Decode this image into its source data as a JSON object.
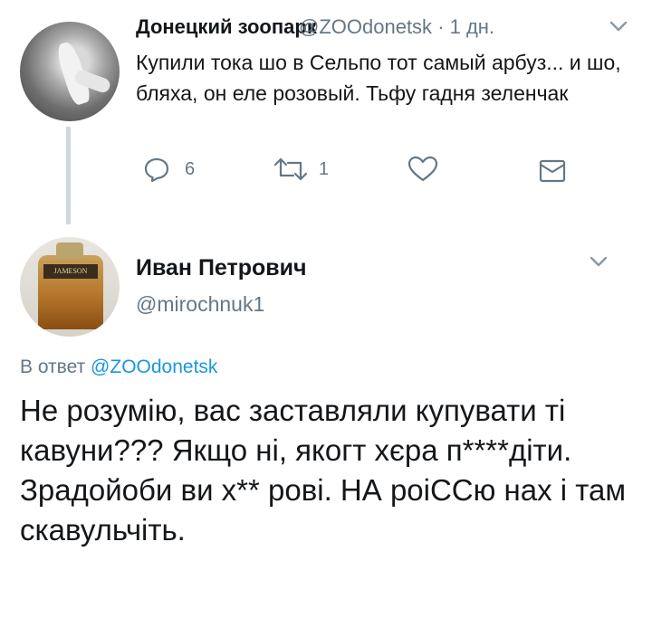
{
  "parent_tweet": {
    "author_name": "Донецкий зоопарк",
    "author_handle": "@ZOOdonetsk",
    "time": "· 1 дн.",
    "text": "Купили тока шо в Сельпо тот самый арбуз... и шо, бляха, он еле розовый. Тьфу гадня зеленчак",
    "reply_count": "6",
    "retweet_count": "1",
    "icons": {
      "reply": "reply-icon",
      "retweet": "retweet-icon",
      "like": "heart-icon",
      "dm": "envelope-icon",
      "menu": "chevron-down-icon"
    }
  },
  "reply_tweet": {
    "author_name": "Иван Петрович",
    "author_handle": "@mirochnuk1",
    "avatar_label": "JAMESON",
    "reply_prefix": "В ответ",
    "reply_to_handle": "@ZOOdonetsk",
    "text": "Не розумію, вас заставляли купувати ті кавуни??? Якщо ні, якогт хєра п****діти. Зрадойоби ви х** рові. НА роіССю нах і там скавульчіть."
  },
  "colors": {
    "link": "#1b95e0",
    "muted": "#657786",
    "text": "#14171a"
  }
}
